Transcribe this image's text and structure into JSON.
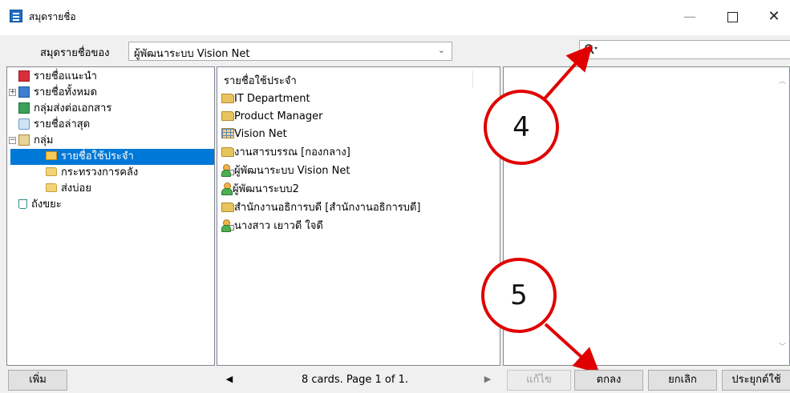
{
  "window": {
    "title": "สมุดรายชื่อ",
    "minimize_glyph": "—",
    "close_glyph": "✕"
  },
  "toolbar": {
    "address_book_label": "สมุดรายชื่อของ",
    "address_book_value": "ผู้พัฒนาระบบ Vision Net",
    "search_value": ""
  },
  "tree": {
    "items": [
      {
        "label": "รายชื่อแนะนำ",
        "icon": "recommended-icon"
      },
      {
        "label": "รายชื่อทั้งหมด",
        "icon": "all-contacts-icon",
        "expander": "+"
      },
      {
        "label": "กลุ่มส่งต่อเอกสาร",
        "icon": "forward-group-icon"
      },
      {
        "label": "รายชื่อล่าสุด",
        "icon": "recent-icon"
      },
      {
        "label": "กลุ่ม",
        "icon": "groups-icon",
        "expander": "−"
      },
      {
        "label": "รายชื่อใช้ประจำ",
        "icon": "frequent-folder-icon",
        "selected": true
      },
      {
        "label": "กระทรวงการคลัง",
        "icon": "folder-icon"
      },
      {
        "label": "ส่งบ่อย",
        "icon": "folder-icon"
      },
      {
        "label": "ถังขยะ",
        "icon": "trash-icon"
      }
    ]
  },
  "list": {
    "header": "รายชื่อใช้ประจำ",
    "items": [
      {
        "label": "IT Department",
        "icon": "group-folder-icon"
      },
      {
        "label": "Product Manager",
        "icon": "group-folder-icon"
      },
      {
        "label": "Vision Net",
        "icon": "organization-icon"
      },
      {
        "label": "งานสารบรรณ [กองกลาง]",
        "icon": "group-folder-icon"
      },
      {
        "label": "ผู้พัฒนาระบบ Vision Net",
        "icon": "person-card-icon"
      },
      {
        "label": "ผู้พัฒนาระบบ2",
        "icon": "person-icon"
      },
      {
        "label": "สำนักงานอธิการบดี [สำนักงานอธิการบดี]",
        "icon": "group-folder-icon"
      },
      {
        "label": "นางสาว เยาวดี ใจดี",
        "icon": "person-card-icon"
      }
    ]
  },
  "callouts": {
    "c4": "4",
    "c5": "5",
    "color": "#e00000"
  },
  "footer": {
    "add_label": "เพิ่ม",
    "prev_glyph": "◀",
    "next_glyph": "▶",
    "pager_text": "8 cards. Page 1 of 1.",
    "edit_label": "แก้ไข",
    "ok_label": "ตกลง",
    "cancel_label": "ยกเลิก",
    "apply_label": "ประยุกต์ใช้"
  },
  "colors": {
    "selection": "#0078d7",
    "annotation": "#e00000"
  }
}
